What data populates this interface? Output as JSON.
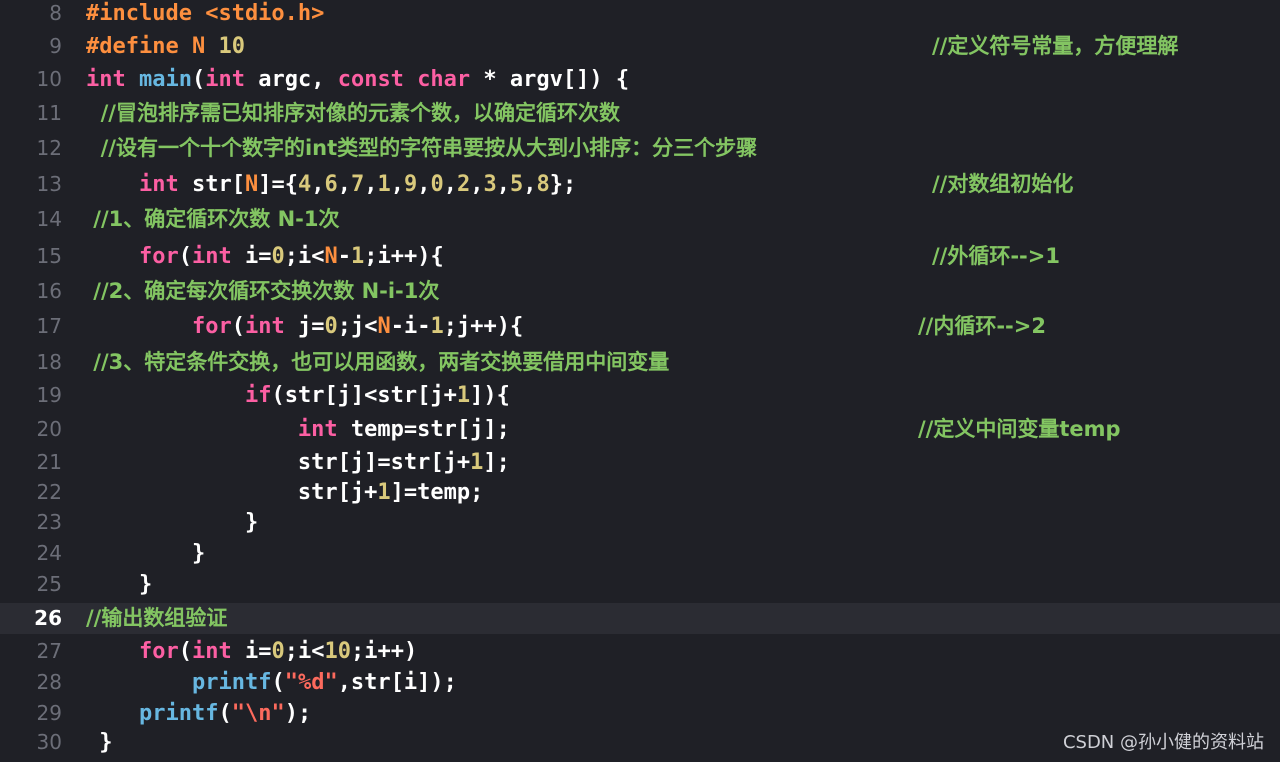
{
  "editor": {
    "current_line": "26",
    "lines": [
      {
        "n": "8",
        "tokens": [
          {
            "t": "#include <stdio.h>",
            "c": "pp"
          }
        ]
      },
      {
        "n": "9",
        "tokens": [
          {
            "t": "#define ",
            "c": "pp"
          },
          {
            "t": "N ",
            "c": "pp"
          },
          {
            "t": "10",
            "c": "num"
          }
        ],
        "right": "//定义符号常量，方便理解"
      },
      {
        "n": "10",
        "tokens": [
          {
            "t": "int",
            "c": "k"
          },
          {
            "t": " "
          },
          {
            "t": "main",
            "c": "fn"
          },
          {
            "t": "("
          },
          {
            "t": "int",
            "c": "k"
          },
          {
            "t": " argc, "
          },
          {
            "t": "const",
            "c": "k"
          },
          {
            "t": " "
          },
          {
            "t": "char",
            "c": "k"
          },
          {
            "t": " * argv[]) {"
          }
        ]
      },
      {
        "n": "11",
        "tokens": [
          {
            "t": "  //冒泡排序需已知排序对像的元素个数，以确定循环次数",
            "c": "cm"
          }
        ]
      },
      {
        "n": "12",
        "tokens": [
          {
            "t": "  //设有一个十个数字的int类型的字符串要按从大到小排序：分三个步骤",
            "c": "cm"
          }
        ]
      },
      {
        "n": "13",
        "tokens": [
          {
            "t": "    "
          },
          {
            "t": "int",
            "c": "k"
          },
          {
            "t": " str["
          },
          {
            "t": "N",
            "c": "pp"
          },
          {
            "t": "]={"
          },
          {
            "t": "4",
            "c": "num"
          },
          {
            "t": ","
          },
          {
            "t": "6",
            "c": "num"
          },
          {
            "t": ","
          },
          {
            "t": "7",
            "c": "num"
          },
          {
            "t": ","
          },
          {
            "t": "1",
            "c": "num"
          },
          {
            "t": ","
          },
          {
            "t": "9",
            "c": "num"
          },
          {
            "t": ","
          },
          {
            "t": "0",
            "c": "num"
          },
          {
            "t": ","
          },
          {
            "t": "2",
            "c": "num"
          },
          {
            "t": ","
          },
          {
            "t": "3",
            "c": "num"
          },
          {
            "t": ","
          },
          {
            "t": "5",
            "c": "num"
          },
          {
            "t": ","
          },
          {
            "t": "8",
            "c": "num"
          },
          {
            "t": "};"
          }
        ],
        "right": "//对数组初始化"
      },
      {
        "n": "14",
        "tokens": [
          {
            "t": " //1、确定循环次数 N-1次",
            "c": "cm"
          }
        ]
      },
      {
        "n": "15",
        "tokens": [
          {
            "t": "    "
          },
          {
            "t": "for",
            "c": "k"
          },
          {
            "t": "("
          },
          {
            "t": "int",
            "c": "k"
          },
          {
            "t": " i="
          },
          {
            "t": "0",
            "c": "num"
          },
          {
            "t": ";i<"
          },
          {
            "t": "N",
            "c": "pp"
          },
          {
            "t": "-"
          },
          {
            "t": "1",
            "c": "num"
          },
          {
            "t": ";i++){"
          }
        ],
        "right": "//外循环-->1"
      },
      {
        "n": "16",
        "tokens": [
          {
            "t": " //2、确定每次循环交换次数 N-i-1次",
            "c": "cm"
          }
        ]
      },
      {
        "n": "17",
        "tokens": [
          {
            "t": "        "
          },
          {
            "t": "for",
            "c": "k"
          },
          {
            "t": "("
          },
          {
            "t": "int",
            "c": "k"
          },
          {
            "t": " j="
          },
          {
            "t": "0",
            "c": "num"
          },
          {
            "t": ";j<"
          },
          {
            "t": "N",
            "c": "pp"
          },
          {
            "t": "-i-"
          },
          {
            "t": "1",
            "c": "num"
          },
          {
            "t": ";j++){"
          }
        ],
        "right": "//内循环-->2"
      },
      {
        "n": "18",
        "tokens": [
          {
            "t": " //3、特定条件交换，也可以用函数，两者交换要借用中间变量",
            "c": "cm"
          }
        ]
      },
      {
        "n": "19",
        "tokens": [
          {
            "t": "            "
          },
          {
            "t": "if",
            "c": "k"
          },
          {
            "t": "(str[j]<str[j+"
          },
          {
            "t": "1",
            "c": "num"
          },
          {
            "t": "]){"
          }
        ]
      },
      {
        "n": "20",
        "tokens": [
          {
            "t": "                "
          },
          {
            "t": "int",
            "c": "k"
          },
          {
            "t": " temp=str[j];"
          }
        ],
        "right": "//定义中间变量temp"
      },
      {
        "n": "21",
        "tokens": [
          {
            "t": "                str[j]=str[j+"
          },
          {
            "t": "1",
            "c": "num"
          },
          {
            "t": "];"
          }
        ]
      },
      {
        "n": "22",
        "tokens": [
          {
            "t": "                str[j+"
          },
          {
            "t": "1",
            "c": "num"
          },
          {
            "t": "]=temp;"
          }
        ]
      },
      {
        "n": "23",
        "tokens": [
          {
            "t": "            }"
          }
        ]
      },
      {
        "n": "24",
        "tokens": [
          {
            "t": "        }"
          }
        ]
      },
      {
        "n": "25",
        "tokens": [
          {
            "t": "    }"
          }
        ]
      },
      {
        "n": "26",
        "tokens": [
          {
            "t": "//输出数组验证",
            "c": "cm"
          }
        ]
      },
      {
        "n": "27",
        "tokens": [
          {
            "t": "    "
          },
          {
            "t": "for",
            "c": "k"
          },
          {
            "t": "("
          },
          {
            "t": "int",
            "c": "k"
          },
          {
            "t": " i="
          },
          {
            "t": "0",
            "c": "num"
          },
          {
            "t": ";i<"
          },
          {
            "t": "10",
            "c": "num"
          },
          {
            "t": ";i++)"
          }
        ]
      },
      {
        "n": "28",
        "tokens": [
          {
            "t": "        "
          },
          {
            "t": "printf",
            "c": "fn"
          },
          {
            "t": "("
          },
          {
            "t": "\"%d\"",
            "c": "str"
          },
          {
            "t": ",str[i]);"
          }
        ]
      },
      {
        "n": "29",
        "tokens": [
          {
            "t": "    "
          },
          {
            "t": "printf",
            "c": "fn"
          },
          {
            "t": "("
          },
          {
            "t": "\"\\n\"",
            "c": "str"
          },
          {
            "t": ");"
          }
        ]
      },
      {
        "n": "30",
        "tokens": [
          {
            "t": " }"
          }
        ]
      }
    ]
  },
  "watermark": "CSDN @孙小健的资料站",
  "colors": {
    "background": "#1f2026",
    "current_line": "#2b2c33",
    "keyword": "#fc5fa3",
    "function": "#67b7e1",
    "preprocessor": "#fd8f3f",
    "number": "#d9c97c",
    "string": "#fc6a5d",
    "comment": "#83c562"
  }
}
